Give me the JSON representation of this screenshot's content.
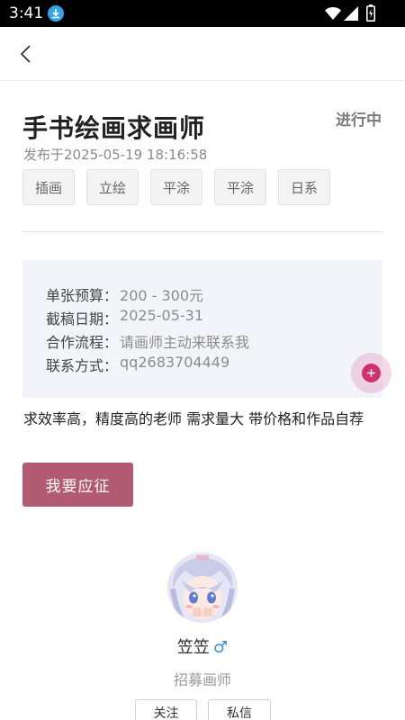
{
  "status_bar": {
    "time": "3:41"
  },
  "post": {
    "title": "手书绘画求画师",
    "status": "进行中",
    "published": "发布于2025-05-19 18:16:58",
    "tags": [
      "插画",
      "立绘",
      "平涂",
      "平涂",
      "日系"
    ],
    "details": [
      {
        "label": "单张预算：",
        "value": "200 - 300元"
      },
      {
        "label": "截稿日期：",
        "value": "2025-05-31"
      },
      {
        "label": "合作流程：",
        "value": "请画师主动来联系我"
      },
      {
        "label": "联系方式：",
        "value": "qq2683704449"
      }
    ],
    "description": "求效率高，精度高的老师 需求量大 带价格和作品自荐",
    "apply_label": "我要应征"
  },
  "author": {
    "name": "笠笠",
    "gender_symbol": "♂",
    "role": "招募画师",
    "follow_label": "关注",
    "message_label": "私信"
  },
  "colors": {
    "accent": "#b35a73",
    "fab": "#d1306e",
    "panel": "#f2f4f9"
  }
}
